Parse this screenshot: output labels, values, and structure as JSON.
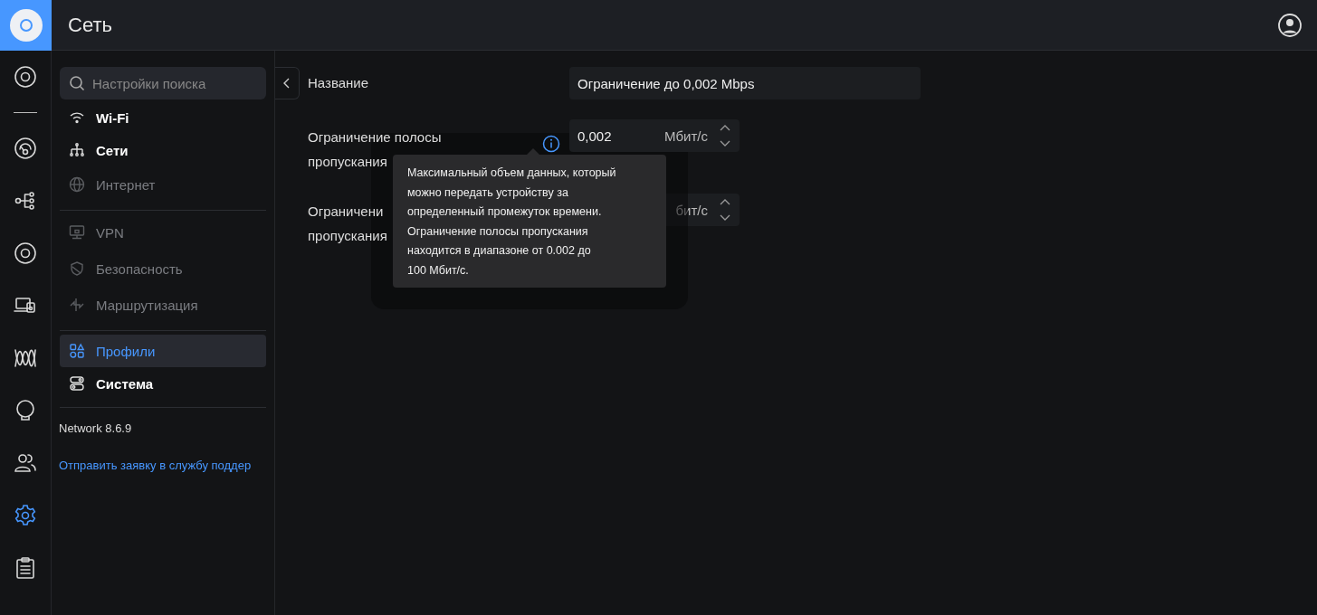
{
  "header": {
    "title": "Сеть"
  },
  "rail": [
    {
      "kind": "ring",
      "selected": false
    },
    {
      "kind": "gateway",
      "selected": false
    },
    {
      "kind": "topology",
      "selected": false
    },
    {
      "kind": "ring",
      "selected": false
    },
    {
      "kind": "devices",
      "selected": false
    },
    {
      "kind": "wave",
      "selected": false
    },
    {
      "kind": "bulb",
      "selected": false
    },
    {
      "kind": "people",
      "selected": false
    },
    {
      "kind": "gear",
      "selected": true
    },
    {
      "kind": "clipboard",
      "selected": false
    }
  ],
  "sidebar": {
    "search": {
      "placeholder": "Настройки поиска"
    },
    "groups": [
      [
        {
          "label": "Wi-Fi",
          "kind": "wifi",
          "disabled": false,
          "selected": false
        },
        {
          "label": "Сети",
          "kind": "tree",
          "disabled": false,
          "selected": false
        },
        {
          "label": "Интернет",
          "kind": "globe",
          "disabled": true,
          "selected": false
        }
      ],
      [
        {
          "label": "VPN",
          "kind": "monitor",
          "disabled": true,
          "selected": false
        },
        {
          "label": "Безопасность",
          "kind": "shield",
          "disabled": true,
          "selected": false
        },
        {
          "label": "Маршрутизация",
          "kind": "routes",
          "disabled": true,
          "selected": false
        }
      ],
      [
        {
          "label": "Профили",
          "kind": "shapes",
          "disabled": false,
          "selected": true
        },
        {
          "label": "Система",
          "kind": "toggles",
          "disabled": false,
          "selected": false
        }
      ]
    ],
    "version": "Network 8.6.9",
    "support_link": "Отправить заявку в службу поддер"
  },
  "form": {
    "rows": [
      {
        "kind": "text",
        "label": [
          "Название"
        ],
        "value": "Ограничение до 0,002 Mbps"
      },
      {
        "kind": "number",
        "label": [
          "Ограничение полосы",
          "пропускания"
        ],
        "info": true,
        "value": "0,002",
        "unit": "Мбит/с"
      },
      {
        "kind": "number",
        "label": [
          "Ограничени",
          "пропускания"
        ],
        "unit": "бит/с"
      }
    ]
  },
  "tooltip": {
    "lines": [
      "Максимальный объем данных, который",
      "можно передать устройству за",
      "определенный промежуток времени.",
      "Ограничение полосы пропускания",
      "находится в диапазоне от 0.002 до",
      "100 Мбит/с."
    ]
  }
}
